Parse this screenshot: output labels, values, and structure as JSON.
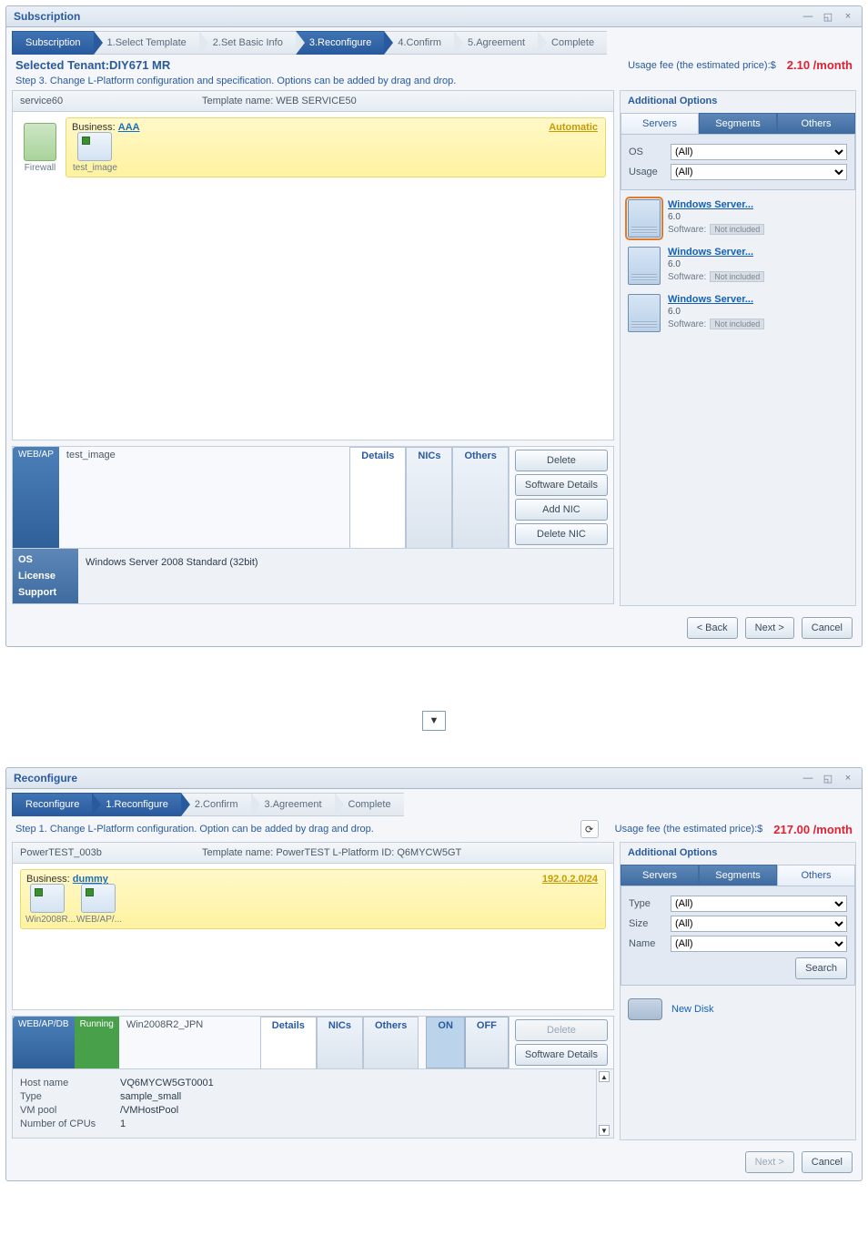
{
  "win1": {
    "title": "Subscription",
    "steps": [
      "1.Select Template",
      "2.Set Basic Info",
      "3.Reconfigure",
      "4.Confirm",
      "5.Agreement",
      "Complete"
    ],
    "active_step_index": 2,
    "selected_tenant_label": "Selected Tenant:DIY671 MR",
    "fee_label": "Usage fee (the estimated price):$",
    "fee_value": "2.10 /month",
    "instruction": "Step 3. Change L-Platform configuration and specification. Options can be added by drag and drop.",
    "service_name": "service60",
    "template_label": "Template name: WEB SERVICE50",
    "business_label": "Business:",
    "business_link": "AAA",
    "automatic_label": "Automatic",
    "canvas_firewall_caption": "Firewall",
    "canvas_server_caption": "test_image",
    "right": {
      "title": "Additional Options",
      "tabs": [
        "Servers",
        "Segments",
        "Others"
      ],
      "form": {
        "os_label": "OS",
        "os_value": "(All)",
        "usage_label": "Usage",
        "usage_value": "(All)"
      },
      "servers": [
        {
          "name": "Windows Server...",
          "size": "6.0",
          "soft": "Not included"
        },
        {
          "name": "Windows Server...",
          "size": "6.0",
          "soft": "Not included"
        },
        {
          "name": "Windows Server...",
          "size": "6.0",
          "soft": "Not included"
        }
      ],
      "software_label": "Software:"
    },
    "props": {
      "type_tag": "WEB/AP",
      "name": "test_image",
      "tabs": [
        "Details",
        "NICs",
        "Others"
      ],
      "side_buttons": [
        "Delete",
        "Software Details",
        "Add NIC",
        "Delete NIC"
      ],
      "rows": {
        "os_k": "OS",
        "os_v": "Windows Server 2008 Standard (32bit)",
        "lic_k": "License",
        "sup_k": "Support"
      }
    },
    "footer": {
      "back": "< Back",
      "next": "Next >",
      "cancel": "Cancel"
    }
  },
  "win2": {
    "title": "Reconfigure",
    "steps": [
      "1.Reconfigure",
      "2.Confirm",
      "3.Agreement",
      "Complete"
    ],
    "active_step_index": 0,
    "instruction": "Step 1. Change L-Platform configuration. Option can be added by drag and drop.",
    "fee_label": "Usage fee (the estimated price):$",
    "fee_value": "217.00 /month",
    "service_name": "PowerTEST_003b",
    "template_label": "Template name: PowerTEST  L-Platform ID: Q6MYCW5GT",
    "business_label": "Business:",
    "business_link": "dummy",
    "ip_text": "192.0.2.0/24",
    "servers": {
      "left_caption": "Win2008R...",
      "right_caption": "WEB/AP/..."
    },
    "right": {
      "title": "Additional Options",
      "tabs": [
        "Servers",
        "Segments",
        "Others"
      ],
      "form": {
        "type": "Type",
        "type_v": "(All)",
        "size": "Size",
        "size_v": "(All)",
        "name": "Name",
        "name_v": "(All)",
        "search": "Search"
      },
      "disk_name": "New Disk"
    },
    "props": {
      "type_tag": "WEB/AP/DB",
      "state": "Running",
      "name": "Win2008R2_JPN",
      "tabs": [
        "Details",
        "NICs",
        "Others"
      ],
      "on": "ON",
      "off": "OFF",
      "side_buttons": [
        "Delete",
        "Software Details"
      ],
      "rows": [
        {
          "k": "Host name",
          "v": "VQ6MYCW5GT0001"
        },
        {
          "k": "Type",
          "v": "sample_small"
        },
        {
          "k": "VM pool",
          "v": "/VMHostPool"
        },
        {
          "k": "Number of CPUs",
          "v": "1"
        }
      ]
    },
    "footer": {
      "next": "Next >",
      "cancel": "Cancel"
    }
  }
}
